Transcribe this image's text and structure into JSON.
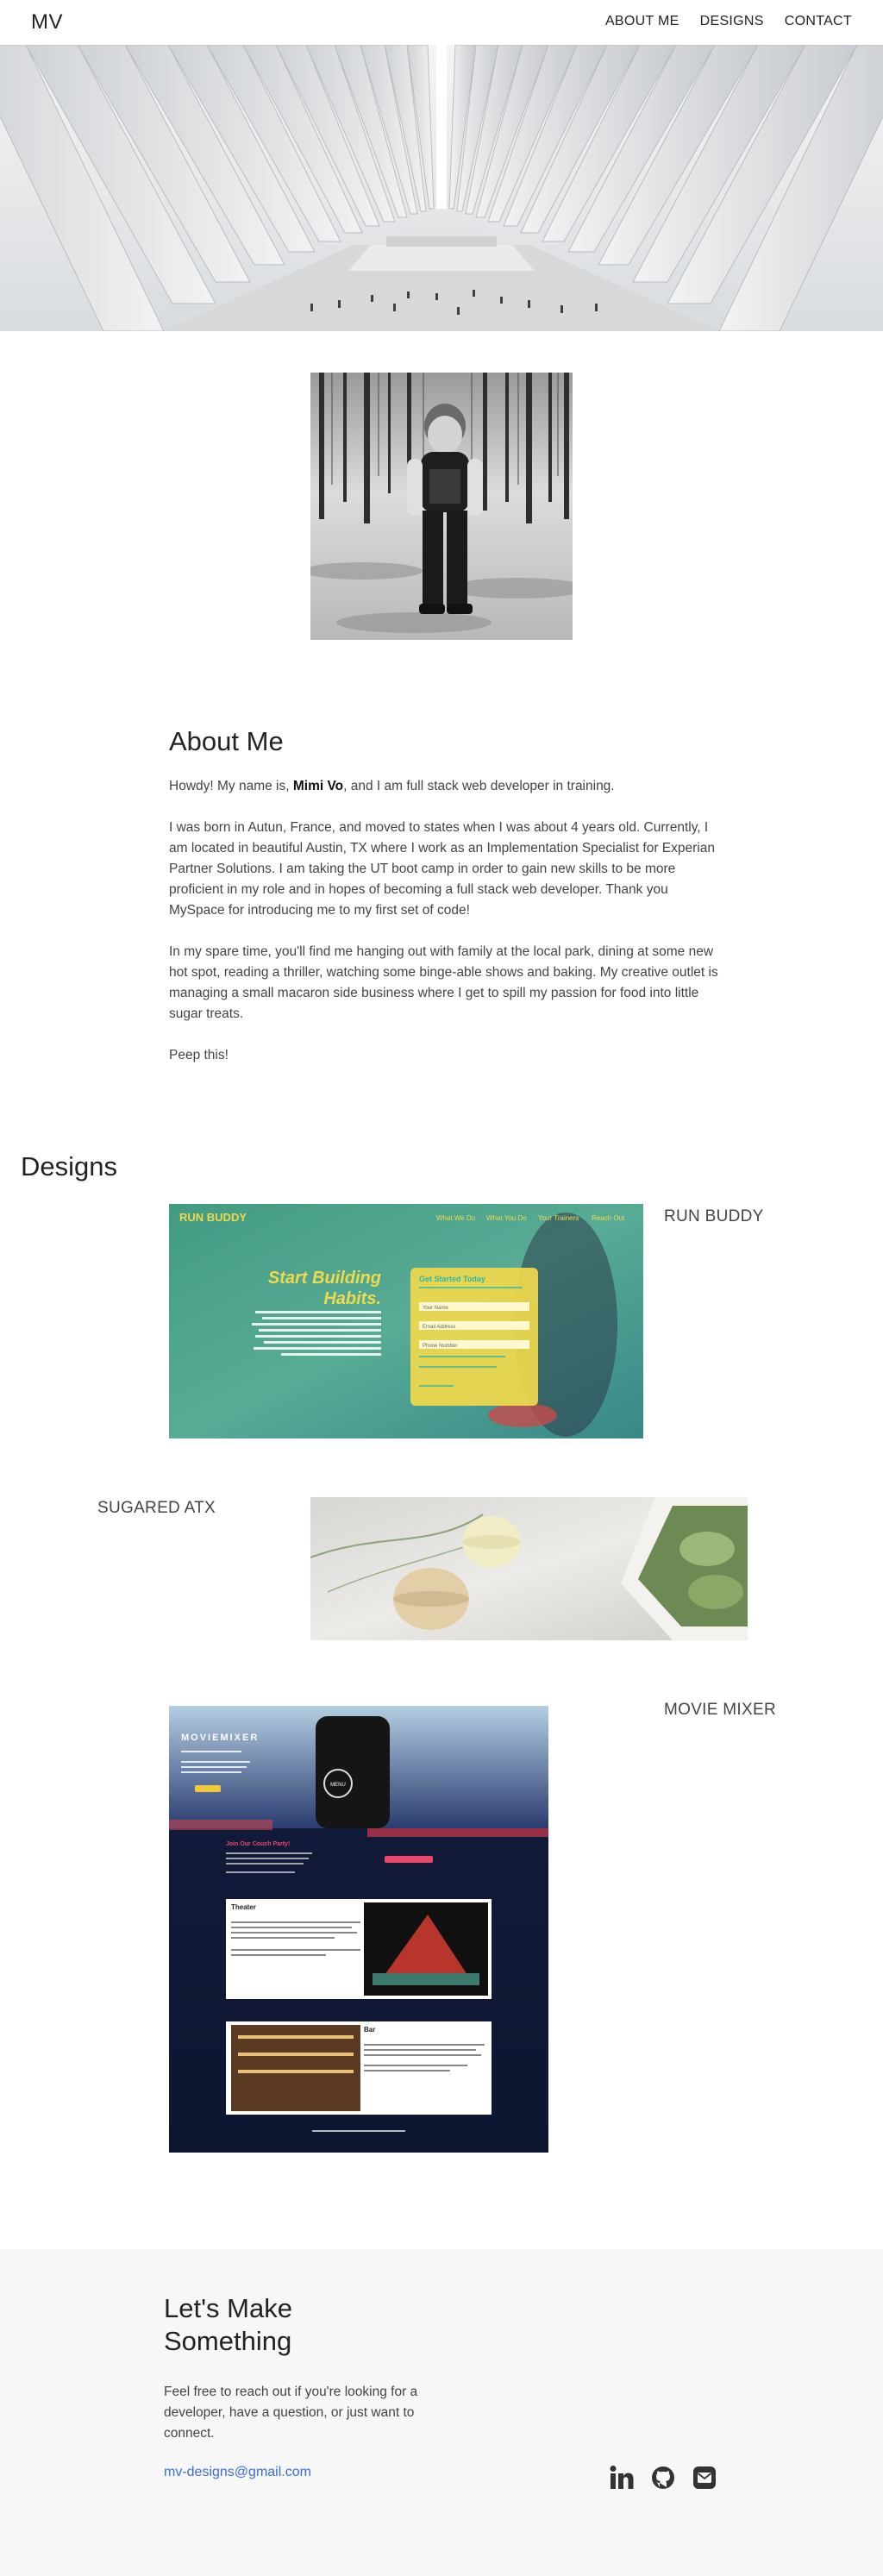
{
  "nav": {
    "brand": "MV",
    "links": [
      "ABOUT ME",
      "DESIGNS",
      "CONTACT"
    ]
  },
  "about": {
    "heading": "About Me",
    "intro_prefix": "Howdy! My name is, ",
    "intro_name": "Mimi Vo",
    "intro_suffix": ", and I am full stack web developer in training.",
    "p2": "I was born in Autun, France, and moved to states when I was about 4 years old. Currently, I am located in beautiful Austin, TX where I work as an Implementation Specialist for Experian Partner Solutions. I am taking the UT boot camp in order to gain new skills to be more proficient in my role and in hopes of becoming a full stack web developer. Thank you MySpace for introducing me to my first set of code!",
    "p3": "In my spare time, you'll find me hanging out with family at the local park, dining at some new hot spot, reading a thriller, watching some binge-able shows and baking. My creative outlet is managing a small macaron side business where I get to spill my passion for food into little sugar treats.",
    "p4": "Peep this!"
  },
  "designs": {
    "heading": "Designs",
    "projects": [
      {
        "label": "RUN BUDDY",
        "shot": {
          "logo": "RUN BUDDY",
          "nav": [
            "What We Do",
            "What You Do",
            "Your Trainers",
            "Reach Out"
          ],
          "headline_1": "Start Building",
          "headline_2": "Habits.",
          "form_title": "Get Started Today",
          "fields": [
            "Your Name",
            "Email Address",
            "Phone Number"
          ]
        }
      },
      {
        "label": "SUGARED ATX"
      },
      {
        "label": "MOVIE MIXER",
        "shot": {
          "logo": "MOVIEMIXER",
          "remote_label": "MENU",
          "party_title": "Join Our Couch Party!",
          "card_1_title": "Theater",
          "card_2_title": "Bar"
        }
      }
    ]
  },
  "contact": {
    "heading": "Let's Make Something",
    "blurb": "Feel free to reach out if you're looking for a developer, have a question, or just want to connect.",
    "email": "mv-designs@gmail.com",
    "icons": [
      "linkedin-icon",
      "github-icon",
      "mail-icon"
    ]
  },
  "colors": {
    "link_blue": "#3b6fd8",
    "runbuddy_yellow": "#f0d94c",
    "runbuddy_teal": "#2fb6a8",
    "moviemixer_navy": "#0e1530",
    "moviemixer_pink": "#e8476b",
    "contact_bg": "#f7f7f7"
  }
}
